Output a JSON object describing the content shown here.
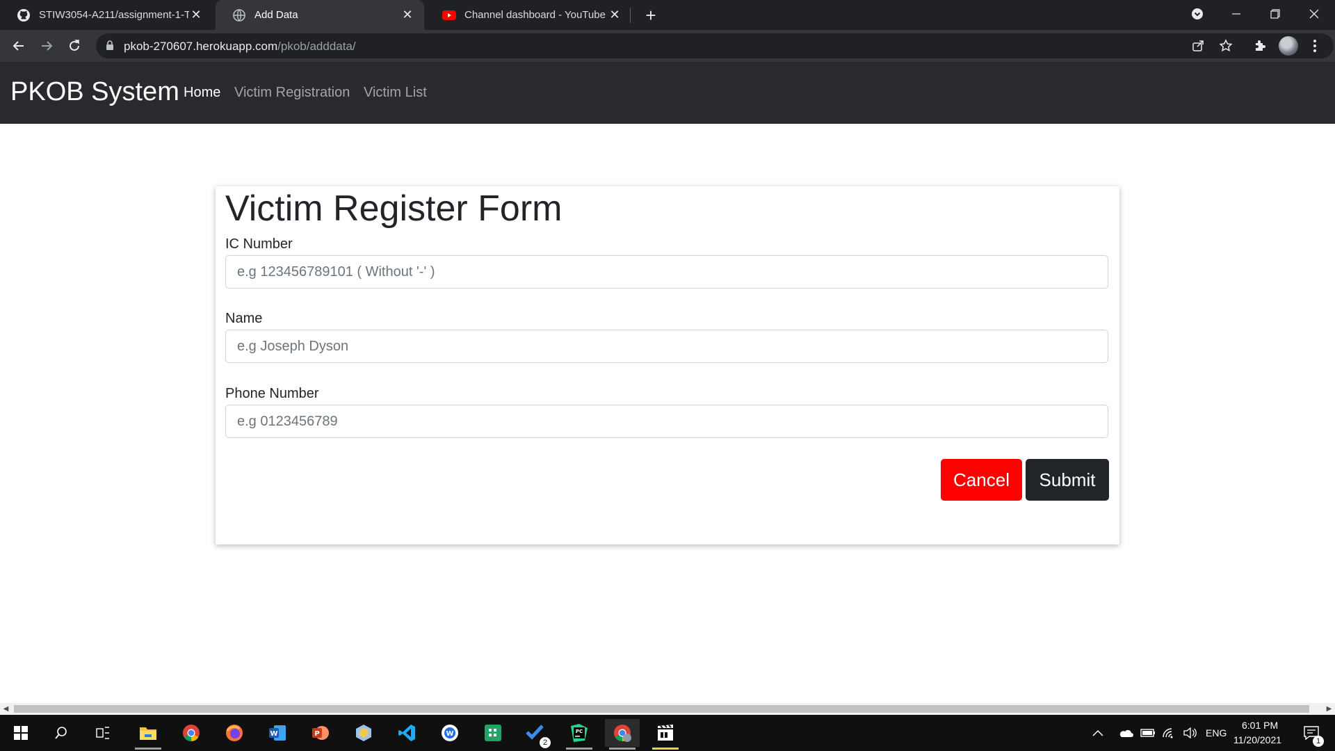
{
  "browser": {
    "tabs": [
      {
        "title": "STIW3054-A211/assignment-1-T",
        "favicon": "github-icon",
        "active": false
      },
      {
        "title": "Add Data",
        "favicon": "globe-icon",
        "active": true
      },
      {
        "title": "Channel dashboard - YouTube St",
        "favicon": "youtube-icon",
        "active": false
      }
    ],
    "url_host": "pkob-270607.herokuapp.com",
    "url_path": "/pkob/adddata/"
  },
  "navbar": {
    "brand": "PKOB System",
    "links": [
      {
        "label": "Home",
        "active": true
      },
      {
        "label": "Victim Registration",
        "active": false
      },
      {
        "label": "Victim List",
        "active": false
      }
    ]
  },
  "form": {
    "title": "Victim Register Form",
    "fields": [
      {
        "label": "IC Number",
        "placeholder": "e.g 123456789101 ( Without '-' )",
        "value": ""
      },
      {
        "label": "Name",
        "placeholder": "e.g Joseph Dyson",
        "value": ""
      },
      {
        "label": "Phone Number",
        "placeholder": "e.g 0123456789",
        "value": ""
      }
    ],
    "cancel_label": "Cancel",
    "submit_label": "Submit"
  },
  "colors": {
    "navbar_bg": "#282a2d",
    "cancel_bg": "#ff0000",
    "submit_bg": "#212529"
  },
  "taskbar": {
    "language": "ENG",
    "time": "6:01 PM",
    "date": "11/20/2021",
    "notification_count": "1",
    "todo_badge": "2"
  }
}
